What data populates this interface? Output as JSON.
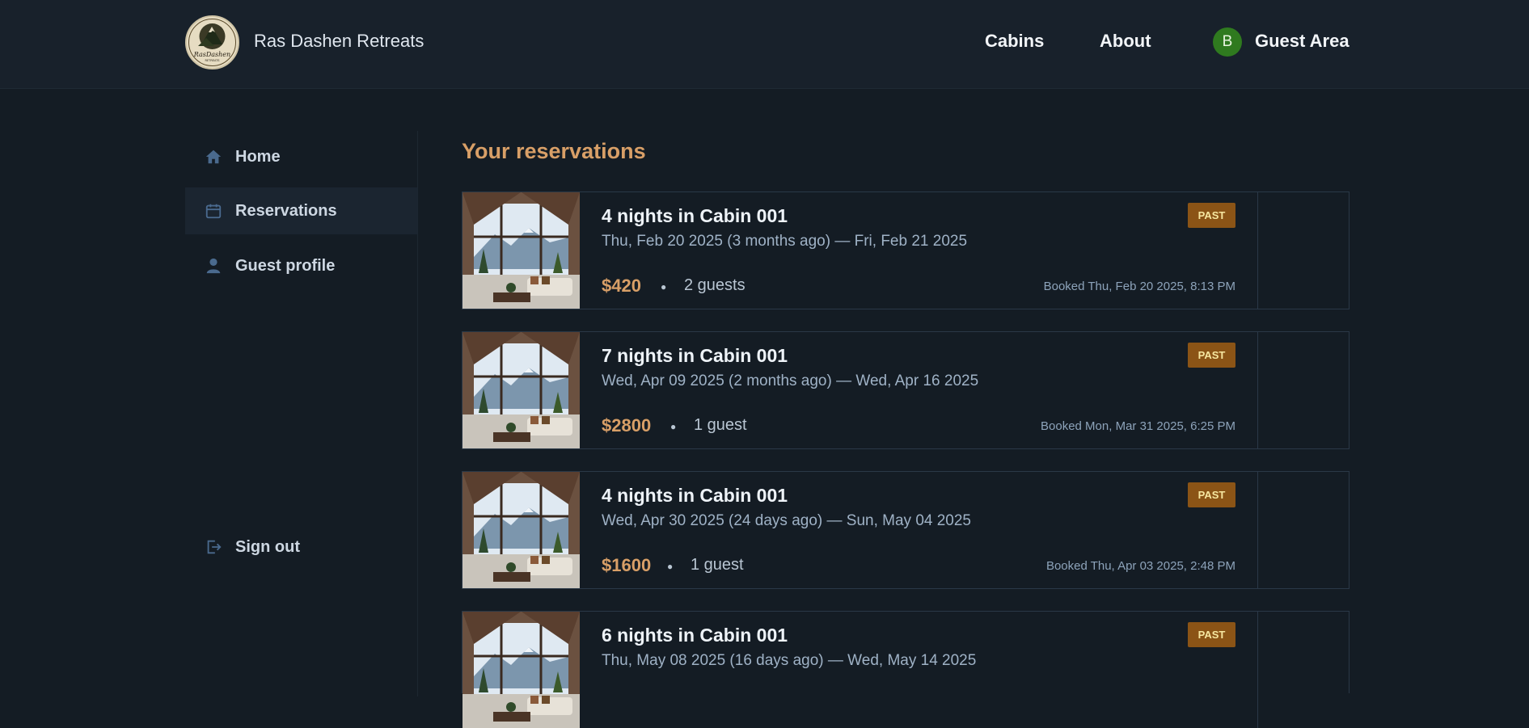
{
  "header": {
    "brand": "Ras Dashen Retreats",
    "logo_text": "RasDashen",
    "nav": [
      {
        "label": "Cabins"
      },
      {
        "label": "About"
      }
    ],
    "avatar_initial": "B",
    "guest_area": "Guest Area"
  },
  "sidebar": {
    "items": [
      {
        "label": "Home",
        "icon": "home-icon"
      },
      {
        "label": "Reservations",
        "icon": "calendar-icon"
      },
      {
        "label": "Guest profile",
        "icon": "user-icon"
      }
    ],
    "sign_out": "Sign out"
  },
  "main": {
    "title": "Your reservations",
    "reservations": [
      {
        "heading": "4 nights in Cabin 001",
        "dates": "Thu, Feb 20 2025 (3 months ago) — Fri, Feb 21 2025",
        "price": "$420",
        "guests": "2 guests",
        "booked": "Booked Thu, Feb 20 2025, 8:13 PM",
        "status": "PAST"
      },
      {
        "heading": "7 nights in Cabin 001",
        "dates": "Wed, Apr 09 2025 (2 months ago) — Wed, Apr 16 2025",
        "price": "$2800",
        "guests": "1 guest",
        "booked": "Booked Mon, Mar 31 2025, 6:25 PM",
        "status": "PAST"
      },
      {
        "heading": "4 nights in Cabin 001",
        "dates": "Wed, Apr 30 2025 (24 days ago) — Sun, May 04 2025",
        "price": "$1600",
        "guests": "1 guest",
        "booked": "Booked Thu, Apr 03 2025, 2:48 PM",
        "status": "PAST"
      },
      {
        "heading": "6 nights in Cabin 001",
        "dates": "Thu, May 08 2025 (16 days ago) — Wed, May 14 2025",
        "price": "",
        "guests": "",
        "booked": "",
        "status": "PAST"
      }
    ]
  },
  "colors": {
    "accent": "#d89f67",
    "background": "#141c24",
    "badge": "#8b5416",
    "avatar": "#2f7a1f"
  }
}
